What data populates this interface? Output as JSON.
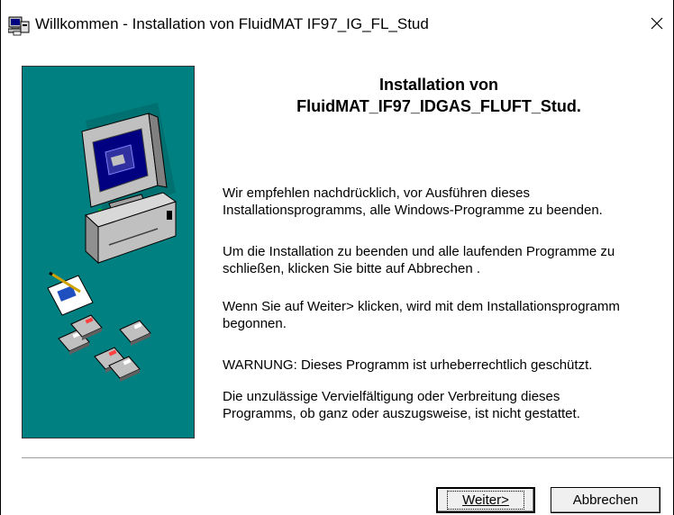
{
  "window": {
    "title": "Willkommen - Installation von FluidMAT IF97_IG_FL_Stud",
    "icon": "setup-computer-icon",
    "close_icon": "close-icon",
    "close_glyph": "✕"
  },
  "main": {
    "heading_line1": "Installation von",
    "heading_line2": "FluidMAT_IF97_IDGAS_FLUFT_Stud.",
    "paragraphs": [
      "Wir empfehlen nachdrücklich, vor Ausführen dieses\nInstallationsprogramms, alle Windows-Programme zu beenden.",
      "Um die Installation zu beenden und alle laufenden Programme zu\nschließen, klicken Sie bitte auf Abbrechen .",
      "Wenn Sie auf Weiter> klicken, wird mit dem Installationsprogramm\nbegonnen.",
      "WARNUNG: Dieses Programm ist urheberrechtlich geschützt.",
      "Die unzulässige Vervielfältigung oder Verbreitung dieses\nProgramms, ob ganz oder auszugsweise, ist nicht gestattet."
    ]
  },
  "side_panel": {
    "illustration": "computer-with-disks-illustration",
    "background_color": "#008080"
  },
  "buttons": {
    "next_label": "Weiter>",
    "cancel_label": "Abbrechen"
  }
}
